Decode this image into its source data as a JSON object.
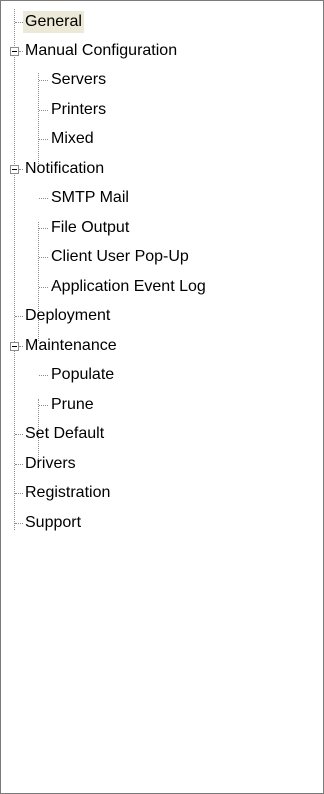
{
  "tree": {
    "general": "General",
    "manual_configuration": {
      "label": "Manual Configuration",
      "expanded": true,
      "children": [
        "Servers",
        "Printers",
        "Mixed"
      ]
    },
    "notification": {
      "label": "Notification",
      "expanded": true,
      "children": [
        "SMTP Mail",
        "File Output",
        "Client User Pop-Up",
        "Application Event Log"
      ]
    },
    "deployment": "Deployment",
    "maintenance": {
      "label": "Maintenance",
      "expanded": true,
      "children": [
        "Populate",
        "Prune"
      ]
    },
    "set_default": "Set Default",
    "drivers": "Drivers",
    "registration": "Registration",
    "support": "Support",
    "selected": "General"
  },
  "colors": {
    "selection_background": "#ece9d8",
    "tree_lines": "#8c8c8c",
    "border": "#7a7a7a"
  },
  "icons": {
    "expanded_node": "minus-box-icon"
  }
}
